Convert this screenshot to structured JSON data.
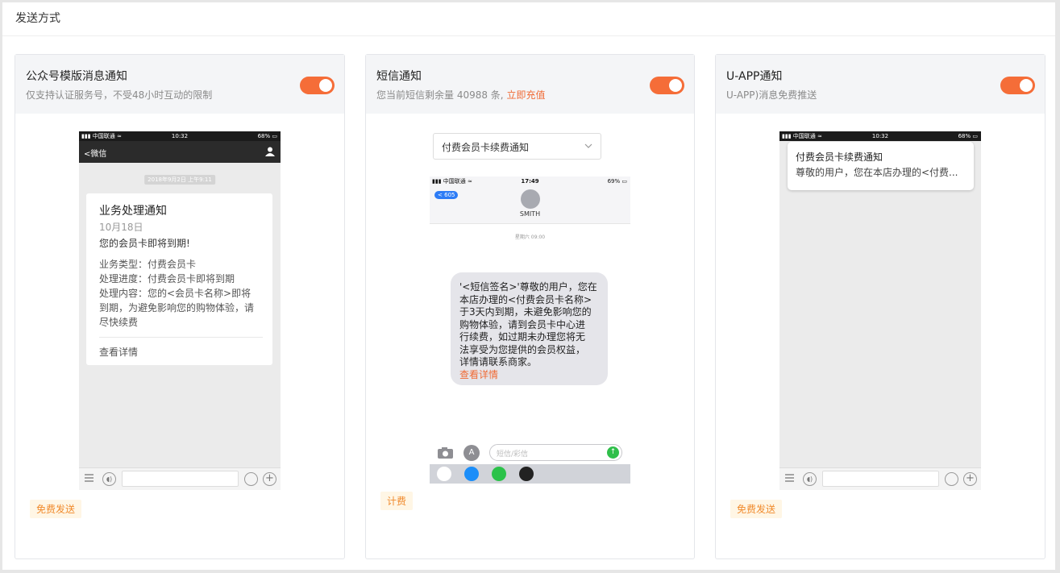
{
  "page": {
    "title": "发送方式"
  },
  "cards": [
    {
      "title": "公众号模版消息通知",
      "subtitle": "仅支持认证服务号，不受48小时互动的限制",
      "enabled": true,
      "badge": "免费发送",
      "phone": {
        "carrier": "中国联通",
        "time": "10:32",
        "battery": "68%",
        "nav_back": "微信",
        "date_pill": "2018年9月2日 上午9:11",
        "message": {
          "title": "业务处理通知",
          "date": "10月18日",
          "lead": "您的会员卡即将到期!",
          "lines": [
            "业务类型：付费会员卡",
            "处理进度：付费会员卡即将到期",
            "处理内容：您的<会员卡名称>即将",
            "到期，为避免影响您的购物体验，请",
            "尽快续费"
          ],
          "link": "查看详情"
        }
      }
    },
    {
      "title": "短信通知",
      "subtitle_prefix": "您当前短信剩余量 40988 条,",
      "subtitle_link": "立即充值",
      "enabled": true,
      "badge": "计费",
      "select": {
        "value": "付费会员卡续费通知"
      },
      "phone": {
        "carrier": "中国联通",
        "time": "17:49",
        "battery": "69%",
        "back_count": "605",
        "contact": "SMITH",
        "timestamp": "星期六 09:00",
        "bubble_lines": [
          "'<短信签名>'尊敬的用户，您在",
          "本店办理的<付费会员卡名称>",
          "于3天内到期，未避免影响您的",
          "购物体验，请到会员卡中心进",
          "行续费，如过期未办理您将无",
          "法享受为您提供的会员权益，",
          "详情请联系商家。"
        ],
        "bubble_link": "查看详情",
        "input_placeholder": "短信/彩信"
      }
    },
    {
      "title": "U-APP通知",
      "subtitle": "U-APP)消息免费推送",
      "enabled": true,
      "badge": "免费发送",
      "phone": {
        "carrier": "中国联通",
        "time": "10:32",
        "battery": "68%",
        "push": {
          "title": "付费会员卡续费通知",
          "text": "尊敬的用户，您在本店办理的<付费..."
        }
      }
    }
  ],
  "colors": {
    "accent": "#f56d38",
    "link": "#f06a35",
    "badge_text": "#f08a2c",
    "badge_bg": "#fff6e5"
  },
  "icons": [
    "signal-icon",
    "wifi-icon",
    "battery-icon",
    "back-chevron-icon",
    "person-icon",
    "list-icon",
    "voice-icon",
    "emoji-icon",
    "plus-icon",
    "chevron-down-icon",
    "camera-icon",
    "appstore-icon",
    "send-icon",
    "photos-icon",
    "music-icon"
  ]
}
